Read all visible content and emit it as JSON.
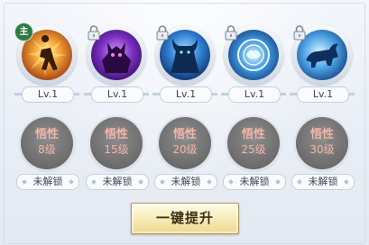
{
  "main_badge": "主",
  "skills": [
    {
      "icon": "fire-warrior-skill-icon",
      "locked": false,
      "is_main": true,
      "level": "Lv.1",
      "req_line1": "悟性",
      "req_line2": "8级",
      "status": "未解锁"
    },
    {
      "icon": "purple-demon-skill-icon",
      "locked": true,
      "is_main": false,
      "level": "Lv.1",
      "req_line1": "悟性",
      "req_line2": "15级",
      "status": "未解锁"
    },
    {
      "icon": "horned-beast-skill-icon",
      "locked": true,
      "is_main": false,
      "level": "Lv.1",
      "req_line1": "悟性",
      "req_line2": "20级",
      "status": "未解锁"
    },
    {
      "icon": "dragon-sigil-skill-icon",
      "locked": true,
      "is_main": false,
      "level": "Lv.1",
      "req_line1": "悟性",
      "req_line2": "25级",
      "status": "未解锁"
    },
    {
      "icon": "charging-ram-skill-icon",
      "locked": true,
      "is_main": false,
      "level": "Lv.1",
      "req_line1": "悟性",
      "req_line2": "30级",
      "status": "未解锁"
    }
  ],
  "upgrade_button": {
    "label": "一键提升"
  }
}
